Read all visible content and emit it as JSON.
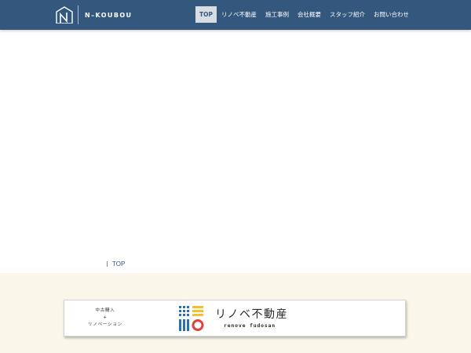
{
  "header": {
    "logo_text": "N–KOUBOU",
    "nav": [
      {
        "label": "TOP",
        "active": true
      },
      {
        "label": "リノベ不動産",
        "active": false
      },
      {
        "label": "施工事例",
        "active": false
      },
      {
        "label": "会社概要",
        "active": false
      },
      {
        "label": "スタッフ紹介",
        "active": false
      },
      {
        "label": "お問い合わせ",
        "active": false
      }
    ]
  },
  "breadcrumb": {
    "current": "TOP"
  },
  "banner": {
    "line1": "中古購入",
    "line2": "+",
    "line3": "リノベーション",
    "title": "リノベ不動産",
    "subtitle": "renove fudosan"
  },
  "colors": {
    "header_bg": "#34587d",
    "active_nav_bg": "#d8dde3",
    "lower_bg": "#faf6ea",
    "mark_blue": "#2a6fb0",
    "mark_yellow": "#f2c12e",
    "mark_red": "#e1413b"
  },
  "icons": {
    "logo": "house-n-logo-icon",
    "banner_mark": "renove-fudosan-logo-icon"
  }
}
